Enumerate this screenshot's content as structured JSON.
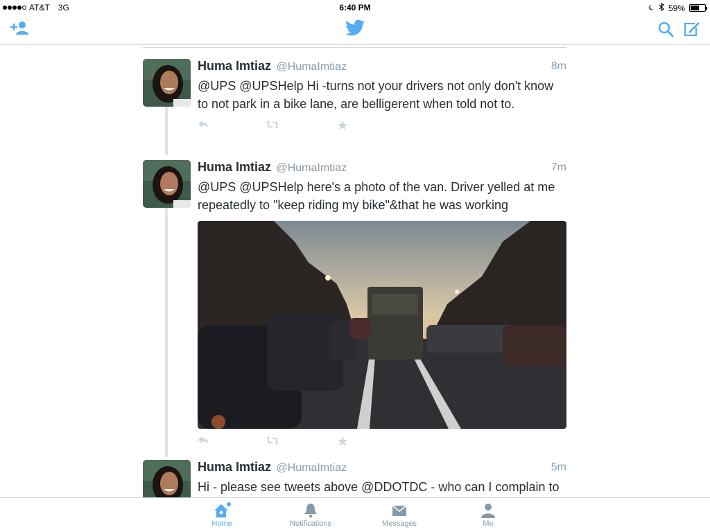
{
  "status_bar": {
    "carrier": "AT&T",
    "network": "3G",
    "time": "6:40 PM",
    "battery": "59%",
    "battery_level": 0.59
  },
  "nav": {
    "icons": [
      "add-user-icon",
      "twitter-bird-icon",
      "search-icon",
      "compose-icon"
    ]
  },
  "colors": {
    "brand": "#55acee",
    "secondary_text": "#8899a6",
    "primary_text": "#292f33"
  },
  "tweets": [
    {
      "name": "Huma Imtiaz",
      "handle": "@HumaImtiaz",
      "time": "8m",
      "text": "@UPS @UPSHelp Hi -turns not your drivers not only don't know to not park in a bike lane, are belligerent when told not to."
    },
    {
      "name": "Huma Imtiaz",
      "handle": "@HumaImtiaz",
      "time": "7m",
      "text": "@UPS @UPSHelp here's a photo of the van. Driver yelled at me repeatedly to \"keep riding my bike\"&that he was working"
    },
    {
      "name": "Huma Imtiaz",
      "handle": "@HumaImtiaz",
      "time": "5m",
      "text": "Hi - please see tweets above @DDOTDC - who can I complain to about bike lane enforcement @OAADC"
    }
  ],
  "tabs": [
    {
      "label": "Home",
      "icon": "home-icon",
      "active": true
    },
    {
      "label": "Notifications",
      "icon": "bell-icon",
      "active": false
    },
    {
      "label": "Messages",
      "icon": "envelope-icon",
      "active": false
    },
    {
      "label": "Me",
      "icon": "person-icon",
      "active": false
    }
  ]
}
